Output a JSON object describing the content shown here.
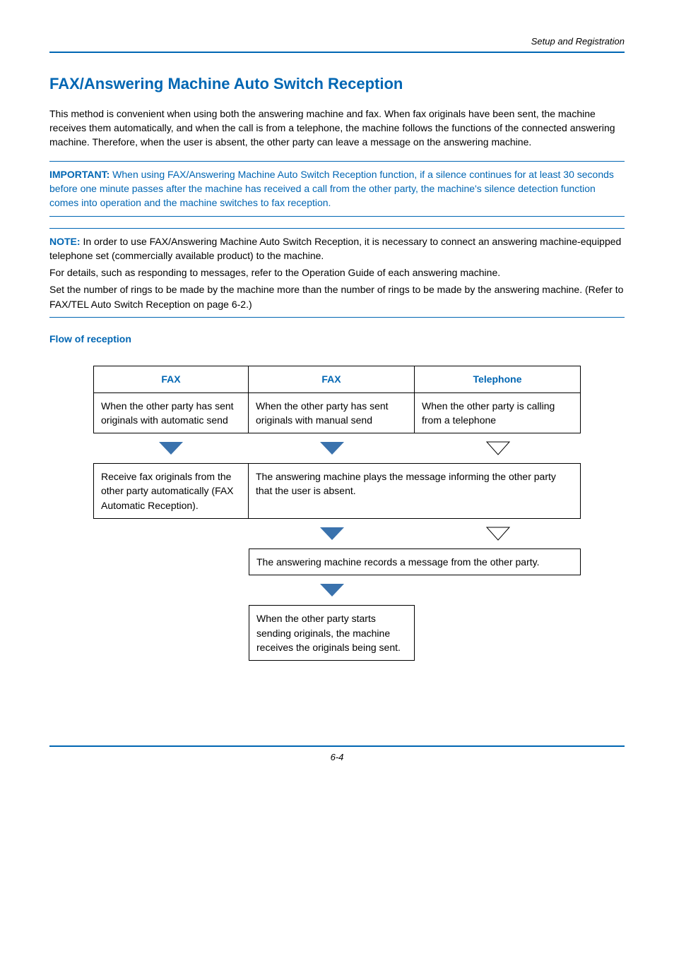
{
  "header": {
    "section": "Setup and Registration"
  },
  "title": "FAX/Answering Machine Auto Switch Reception",
  "intro": "This method is convenient when using both the answering machine and fax. When fax originals have been sent, the machine receives them automatically, and when the call is from a telephone, the machine follows the functions of the connected answering machine. Therefore, when the user is absent, the other party can leave a message on the answering machine.",
  "important": {
    "label": "IMPORTANT:",
    "text": " When using FAX/Answering Machine Auto Switch Reception function, if a silence continues for at least 30 seconds before one minute passes after the machine has received a call from the other party, the machine's silence detection function comes into operation and the machine switches to fax reception."
  },
  "note": {
    "label": "NOTE:",
    "lines": [
      " In order to use FAX/Answering Machine Auto Switch Reception, it is necessary to connect an answering machine-equipped telephone set (commercially available product) to the machine.",
      "For details, such as responding to messages, refer to the Operation Guide of each answering machine.",
      "Set the number of rings to be made by the machine more than the number of rings to be made by the answering machine. (Refer to FAX/TEL Auto Switch Reception on page 6-2.)"
    ]
  },
  "subheading": "Flow of reception",
  "flow": {
    "headers": {
      "a": "FAX",
      "b": "FAX",
      "c": "Telephone"
    },
    "row1": {
      "a": "When the other party has sent originals with automatic send",
      "b": "When the other party has sent originals with manual send",
      "c": "When the other party is calling from a telephone"
    },
    "row2": {
      "a": "Receive fax originals from the other party automatically (FAX Automatic Reception).",
      "bc": "The answering machine plays the message informing the other party that the user is absent."
    },
    "row3": {
      "bc": "The answering machine records a message from the other party."
    },
    "row4": {
      "b": "When the other party starts sending originals, the machine receives the originals being sent."
    }
  },
  "footer": "6-4",
  "colors": {
    "blue": "#0066b3",
    "solidArrow": "#3a72ad"
  }
}
